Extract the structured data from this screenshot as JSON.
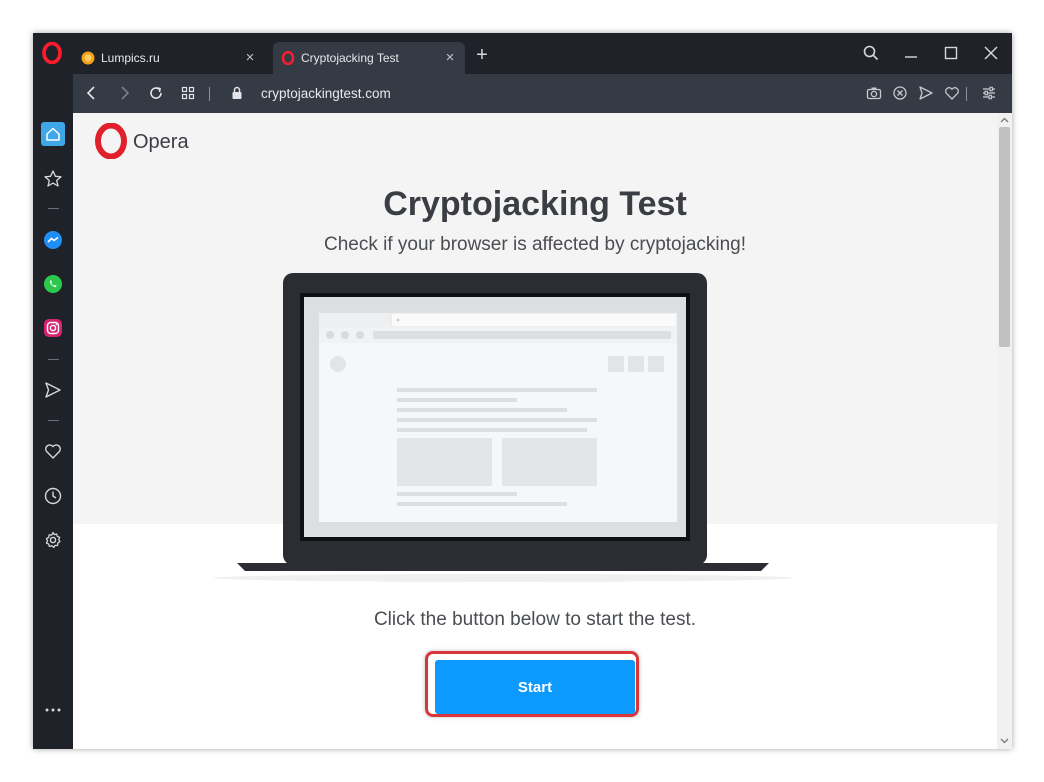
{
  "tabs": [
    {
      "label": "Lumpics.ru",
      "active": false
    },
    {
      "label": "Cryptojacking Test",
      "active": true
    }
  ],
  "address_bar": {
    "url": "cryptojackingtest.com"
  },
  "sidebar": {
    "items": [
      "home-icon",
      "bookmarks-icon",
      "messenger-icon",
      "whatsapp-icon",
      "instagram-icon",
      "flow-icon",
      "my-flow-heart-icon",
      "history-icon",
      "settings-icon",
      "more-icon"
    ]
  },
  "page": {
    "logo_text": "Opera",
    "title": "Cryptojacking Test",
    "subtitle": "Check if your browser is affected by cryptojacking!",
    "instruction": "Click the button below to start the test.",
    "start_label": "Start"
  },
  "colors": {
    "accent_button": "#0c9aff",
    "highlight_border": "#d9353b",
    "opera_red": "#e0212b",
    "chrome_dark": "#1f2228",
    "chrome_mid": "#343b45"
  }
}
